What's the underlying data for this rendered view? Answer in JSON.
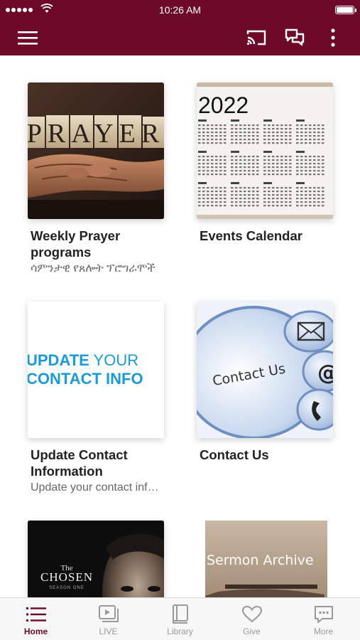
{
  "status": {
    "time": "10:26 AM"
  },
  "colors": {
    "brand": "#6d0a2a",
    "tab_inactive": "#999999"
  },
  "header": {
    "icons": [
      "menu-icon",
      "cast-icon",
      "chat-icon",
      "more-vertical-icon"
    ]
  },
  "cards": [
    {
      "title": "Weekly Prayer programs",
      "subtitle": "ሳምንታዊ የጸሎት ፕሮግራሞች",
      "image_text": "PRAYER"
    },
    {
      "title": "Events Calendar",
      "subtitle": "",
      "image_text": "2022"
    },
    {
      "title": "Update Contact Information",
      "subtitle": "Update your contact information",
      "image_line1_a": "UPDATE",
      "image_line1_b": " YOUR",
      "image_line2": "CONTACT INFO"
    },
    {
      "title": "Contact Us",
      "subtitle": "",
      "image_text": "Contact Us"
    },
    {
      "title": "",
      "subtitle": "",
      "image_text_small": "The",
      "image_text": "CHOSEN",
      "image_text_sub": "SEASON ONE"
    },
    {
      "title": "",
      "subtitle": "",
      "image_text": "Sermon Archive"
    }
  ],
  "tabbar": {
    "tabs": [
      {
        "label": "Home",
        "icon": "list-icon",
        "active": true
      },
      {
        "label": "LIVE",
        "icon": "play-icon",
        "active": false
      },
      {
        "label": "Library",
        "icon": "book-icon",
        "active": false
      },
      {
        "label": "Give",
        "icon": "heart-icon",
        "active": false
      },
      {
        "label": "More",
        "icon": "more-chat-icon",
        "active": false
      }
    ]
  }
}
